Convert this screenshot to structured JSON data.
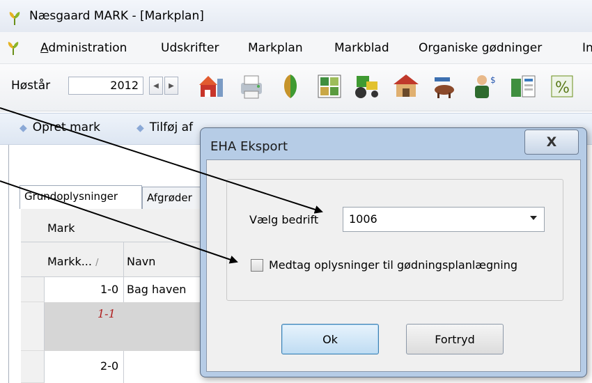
{
  "window": {
    "title": "Næsgaard MARK - [Markplan]"
  },
  "menu": {
    "items": [
      "Administration",
      "Udskrifter",
      "Markplan",
      "Markblad",
      "Organiske gødninger",
      "In"
    ]
  },
  "toolbar": {
    "season_label": "Høstår",
    "season_value": "2012",
    "tools": [
      "farm-icon",
      "printer-icon",
      "crop-icon",
      "field-map-icon",
      "tractor-icon",
      "barn-icon",
      "animals-icon",
      "advisor-icon",
      "calculator-icon",
      "percent-icon"
    ]
  },
  "actions": [
    "Opret mark",
    "Tilføj af"
  ],
  "tabs": [
    "Grundoplysninger",
    "Afgrøder"
  ],
  "grid": {
    "group_header": "Mark",
    "columns": [
      "Markk...",
      "Navn"
    ],
    "rows": [
      {
        "number": "1-0",
        "name": "Bag haven"
      },
      {
        "number": "1-1",
        "name": ""
      },
      {
        "number": "2-0",
        "name": ""
      }
    ]
  },
  "dialog": {
    "title": "EHA Eksport",
    "close_label": "X",
    "company_label": "Vælg bedrift",
    "company_value": "1006",
    "checkbox_label": "Medtag oplysninger til gødningsplanlægning",
    "checkbox_checked": false,
    "ok_label": "Ok",
    "cancel_label": "Fortryd"
  }
}
